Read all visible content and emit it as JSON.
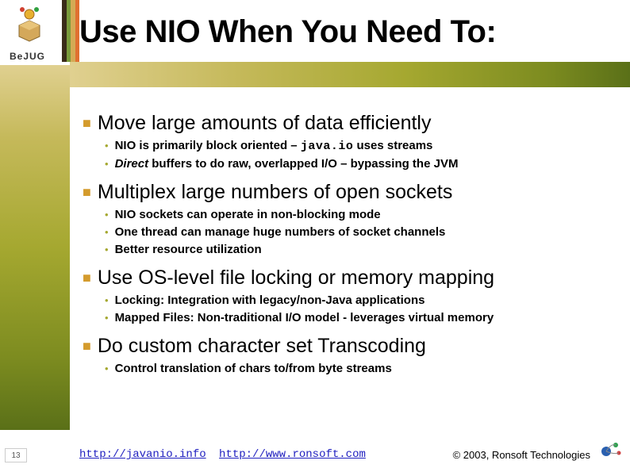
{
  "brand": {
    "name": "BeJUG"
  },
  "title": "Use NIO When You Need To:",
  "colors": {
    "bullet_square": "#d49b2c",
    "bullet_dot": "#a5a830",
    "bars": [
      "#3a2a18",
      "#7a9a3a",
      "#d4aa55",
      "#e07030"
    ]
  },
  "sections": [
    {
      "heading": "Move large amounts of data efficiently",
      "subs": [
        {
          "pre": "NIO is primarily block oriented – ",
          "code": "java.io",
          "post": " uses streams"
        },
        {
          "pre_i": "Direct",
          "post": " buffers to do raw, overlapped I/O – bypassing the JVM"
        }
      ]
    },
    {
      "heading": "Multiplex large numbers of open sockets",
      "subs": [
        {
          "text": "NIO sockets can operate in non-blocking mode"
        },
        {
          "text": "One thread can manage huge numbers of socket channels"
        },
        {
          "text": "Better resource utilization"
        }
      ]
    },
    {
      "heading": "Use OS-level file locking or memory mapping",
      "subs": [
        {
          "text": "Locking: Integration with legacy/non-Java applications"
        },
        {
          "text": "Mapped Files: Non-traditional I/O model - leverages virtual memory"
        }
      ]
    },
    {
      "heading": "Do custom character set Transcoding",
      "subs": [
        {
          "text": "Control translation of chars to/from byte streams"
        }
      ]
    }
  ],
  "footer": {
    "page": "13",
    "link1": "http://javanio.info",
    "link2": "http://www.ronsoft.com",
    "copyright": "© 2003, Ronsoft Technologies"
  }
}
